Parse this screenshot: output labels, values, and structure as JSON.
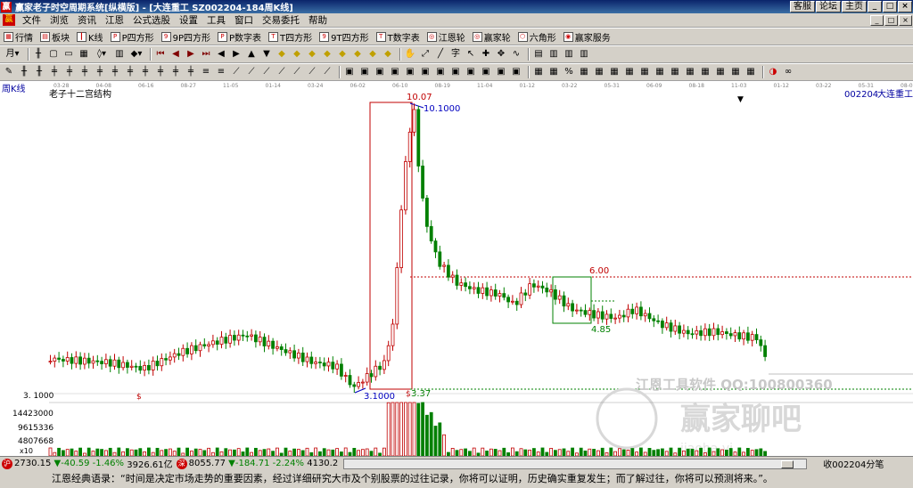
{
  "window": {
    "title": "赢家老子时空周期系统[纵横版] - [大连重工  SZ002204-184周K线]",
    "links": [
      "客服",
      "论坛",
      "主页"
    ],
    "controls": [
      "_",
      "□",
      "×"
    ]
  },
  "menu": {
    "items": [
      "文件",
      "浏览",
      "资讯",
      "江恩",
      "公式选股",
      "设置",
      "工具",
      "窗口",
      "交易委托",
      "帮助"
    ],
    "right_controls": [
      "_",
      "□",
      "×"
    ]
  },
  "toolbar1": {
    "items": [
      "行情",
      "板块",
      "K线",
      "P四方形",
      "9P四方形",
      "P数字表",
      "T四方形",
      "9T四方形",
      "T数字表",
      "江恩轮",
      "赢家轮",
      "六角形",
      "赢家服务"
    ]
  },
  "chart": {
    "period_label": "周K线",
    "indicator_label": "老子十二宫结构",
    "code_label": "002204",
    "name_label": "大连重工",
    "top_dates": [
      "03-28",
      "04-08",
      "06-16",
      "08-27",
      "11-05",
      "01-14",
      "03-24",
      "06-02",
      "06-10",
      "08-19",
      "11-04",
      "01-12",
      "03-22",
      "05-31",
      "06-09",
      "08-18",
      "11-03",
      "01-12",
      "03-22",
      "05-31",
      "08-09"
    ],
    "annotations": {
      "high_box_label": "10.07",
      "high_price": "10.1000",
      "low_price": "3.1000",
      "low_axis": "3. 1000",
      "low_box_label": "3.37",
      "level_label": "6.00",
      "sub_low": "4.85",
      "dollar_mark": "$"
    },
    "volume_axis": [
      "14423000",
      "9615336",
      "4807668"
    ],
    "volume_multiplier": "x10",
    "watermark_text": "江恩工具软件  QQ:100800360",
    "watermark_logo": "赢家聊吧",
    "watermark_url": "jiaoba.yj..."
  },
  "chart_data": {
    "type": "candlestick",
    "title": "老子十二宫结构",
    "price_annotations": {
      "high": 10.1,
      "low": 3.1,
      "box_high": 10.07,
      "box_low": 3.37,
      "level": 6.0,
      "later_low": 4.85
    },
    "volume_ticks": [
      14423000,
      9615336,
      4807668
    ]
  },
  "status": {
    "idx1_value": "2730.15",
    "idx1_change": "▼-40.59",
    "idx1_pct": "-1.46%",
    "idx1_amount": "3926.61亿",
    "idx2_value": "8055.77",
    "idx2_change": "▼-184.71",
    "idx2_pct": "-2.24%",
    "idx2_amount": "4130.2",
    "right_text": "收002204分笔"
  },
  "quote": {
    "text": "江恩经典语录：“时间是决定市场走势的重要因素，经过详细研究大市及个别股票的过往记录，你将可以证明，历史确实重复发生；而了解过往，你将可以预测将来。”。"
  }
}
